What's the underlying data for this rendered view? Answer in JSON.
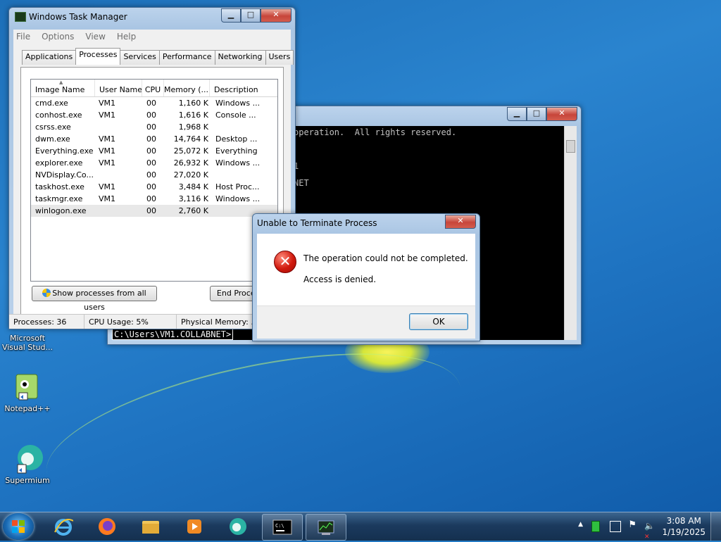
{
  "desktop": {
    "icons": [
      {
        "label": "Microsoft Visual Stud..."
      },
      {
        "label": "Notepad++"
      },
      {
        "label": "Supermium"
      }
    ]
  },
  "taskmgr": {
    "title": "Windows Task Manager",
    "menu": [
      "File",
      "Options",
      "View",
      "Help"
    ],
    "tabs": [
      "Applications",
      "Processes",
      "Services",
      "Performance",
      "Networking",
      "Users"
    ],
    "active_tab": "Processes",
    "columns": [
      "Image Name",
      "User Name",
      "CPU",
      "Memory (...",
      "Description"
    ],
    "rows": [
      {
        "name": "cmd.exe",
        "user": "VM1",
        "cpu": "00",
        "mem": "1,160 K",
        "desc": "Windows ..."
      },
      {
        "name": "conhost.exe",
        "user": "VM1",
        "cpu": "00",
        "mem": "1,616 K",
        "desc": "Console ..."
      },
      {
        "name": "csrss.exe",
        "user": "",
        "cpu": "00",
        "mem": "1,968 K",
        "desc": ""
      },
      {
        "name": "dwm.exe",
        "user": "VM1",
        "cpu": "00",
        "mem": "14,764 K",
        "desc": "Desktop ..."
      },
      {
        "name": "Everything.exe",
        "user": "VM1",
        "cpu": "00",
        "mem": "25,072 K",
        "desc": "Everything"
      },
      {
        "name": "explorer.exe",
        "user": "VM1",
        "cpu": "00",
        "mem": "26,932 K",
        "desc": "Windows ..."
      },
      {
        "name": "NVDisplay.Co...",
        "user": "",
        "cpu": "00",
        "mem": "27,020 K",
        "desc": ""
      },
      {
        "name": "taskhost.exe",
        "user": "VM1",
        "cpu": "00",
        "mem": "3,484 K",
        "desc": "Host Proc..."
      },
      {
        "name": "taskmgr.exe",
        "user": "VM1",
        "cpu": "00",
        "mem": "3,116 K",
        "desc": "Windows ..."
      },
      {
        "name": "winlogon.exe",
        "user": "",
        "cpu": "00",
        "mem": "2,760 K",
        "desc": ""
      }
    ],
    "selected_row": "winlogon.exe",
    "show_all_btn": "Show processes from all users",
    "end_process_btn": "End Process",
    "status": {
      "processes": "Processes: 36",
      "cpu": "CPU Usage: 5%",
      "memory": "Physical Memory: ..."
    }
  },
  "console": {
    "line1": "operation.  All rights reserved.",
    "line2": "1",
    "line3": "NET",
    "prompt": "C:\\Users\\VM1.COLLABNET>"
  },
  "dialog": {
    "title": "Unable to Terminate Process",
    "message": "The operation could not be completed.",
    "detail": "Access is denied.",
    "ok": "OK"
  },
  "taskbar": {
    "pinned": [
      "internet-explorer",
      "firefox",
      "file-explorer",
      "media-player",
      "supermium",
      "cmd",
      "task-manager"
    ]
  },
  "tray": {
    "time": "3:08 AM",
    "date": "1/19/2025"
  },
  "colors": {
    "accent": "#1f74c2",
    "error": "#d11a0e"
  }
}
